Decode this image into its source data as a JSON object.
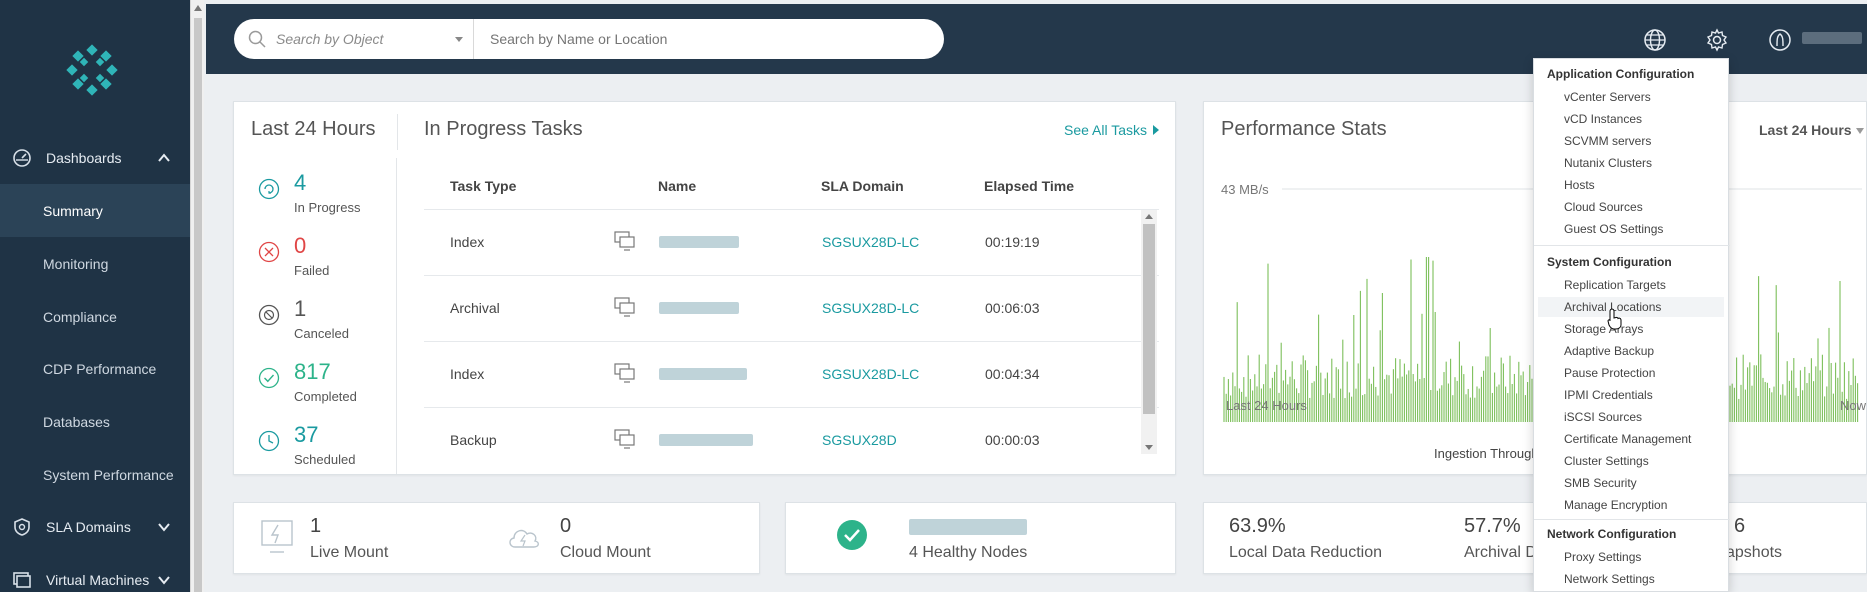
{
  "sidebar": {
    "groups": [
      {
        "label": "Dashboards",
        "icon": "dashboard-icon",
        "expanded": true
      },
      {
        "label": "SLA Domains",
        "icon": "shield-icon",
        "expanded": false
      },
      {
        "label": "Virtual Machines",
        "icon": "vm-icon",
        "expanded": false
      }
    ],
    "items": [
      {
        "label": "Summary",
        "active": true
      },
      {
        "label": "Monitoring"
      },
      {
        "label": "Compliance"
      },
      {
        "label": "CDP Performance"
      },
      {
        "label": "Databases"
      },
      {
        "label": "System Performance"
      }
    ]
  },
  "search": {
    "object_placeholder": "Search by Object",
    "name_placeholder": "Search by Name or Location"
  },
  "topbar": {
    "icons": [
      "globe-icon",
      "gear-icon",
      "user-icon"
    ]
  },
  "tasks": {
    "left_title": "Last 24 Hours",
    "title": "In Progress Tasks",
    "see_all": "See All Tasks",
    "stats": [
      {
        "value": "4",
        "label": "In Progress",
        "color": "#1a9aa0"
      },
      {
        "value": "0",
        "label": "Failed",
        "color": "#e04646"
      },
      {
        "value": "1",
        "label": "Canceled",
        "color": "#555555"
      },
      {
        "value": "817",
        "label": "Completed",
        "color": "#2db38a"
      },
      {
        "value": "37",
        "label": "Scheduled",
        "color": "#1a9aa0"
      }
    ],
    "columns": [
      "Task Type",
      "Name",
      "SLA Domain",
      "Elapsed Time"
    ],
    "rows": [
      {
        "type": "Index",
        "sla": "SGSUX28D-LC",
        "elapsed": "00:19:19"
      },
      {
        "type": "Archival",
        "sla": "SGSUX28D-LC",
        "elapsed": "00:06:03"
      },
      {
        "type": "Index",
        "sla": "SGSUX28D-LC",
        "elapsed": "00:04:34"
      },
      {
        "type": "Backup",
        "sla": "SGSUX28D",
        "elapsed": "00:00:03"
      }
    ]
  },
  "performance": {
    "title": "Performance Stats",
    "range": "Last 24 Hours",
    "y_label": "43 MB/s",
    "x_start": "Last 24 Hours",
    "x_end": "Now",
    "caption": "Ingestion Through",
    "series_color": "#7cbf5a"
  },
  "bottom": {
    "live_mount": {
      "value": "1",
      "label": "Live Mount"
    },
    "cloud_mount": {
      "value": "0",
      "label": "Cloud Mount"
    },
    "nodes": {
      "label": "4 Healthy Nodes"
    },
    "local_reduction": {
      "value": "63.9%",
      "label": "Local Data Reduction"
    },
    "archival": {
      "value": "57.7%",
      "label": "Archival D"
    },
    "snapshots": {
      "value": "6",
      "label": "apshots"
    }
  },
  "settings_menu": {
    "sections": [
      {
        "title": "Application Configuration",
        "items": [
          "vCenter Servers",
          "vCD Instances",
          "SCVMM servers",
          "Nutanix Clusters",
          "Hosts",
          "Cloud Sources",
          "Guest OS Settings"
        ]
      },
      {
        "title": "System Configuration",
        "items": [
          "Replication Targets",
          "Archival Locations",
          "Storage Arrays",
          "Adaptive Backup",
          "Pause Protection",
          "IPMI Credentials",
          "iSCSI Sources",
          "Certificate Management",
          "Cluster Settings",
          "SMB Security",
          "Manage Encryption"
        ]
      },
      {
        "title": "Network Configuration",
        "items": [
          "Proxy Settings",
          "Network Settings"
        ]
      }
    ],
    "hovered": "Archival Locations"
  }
}
